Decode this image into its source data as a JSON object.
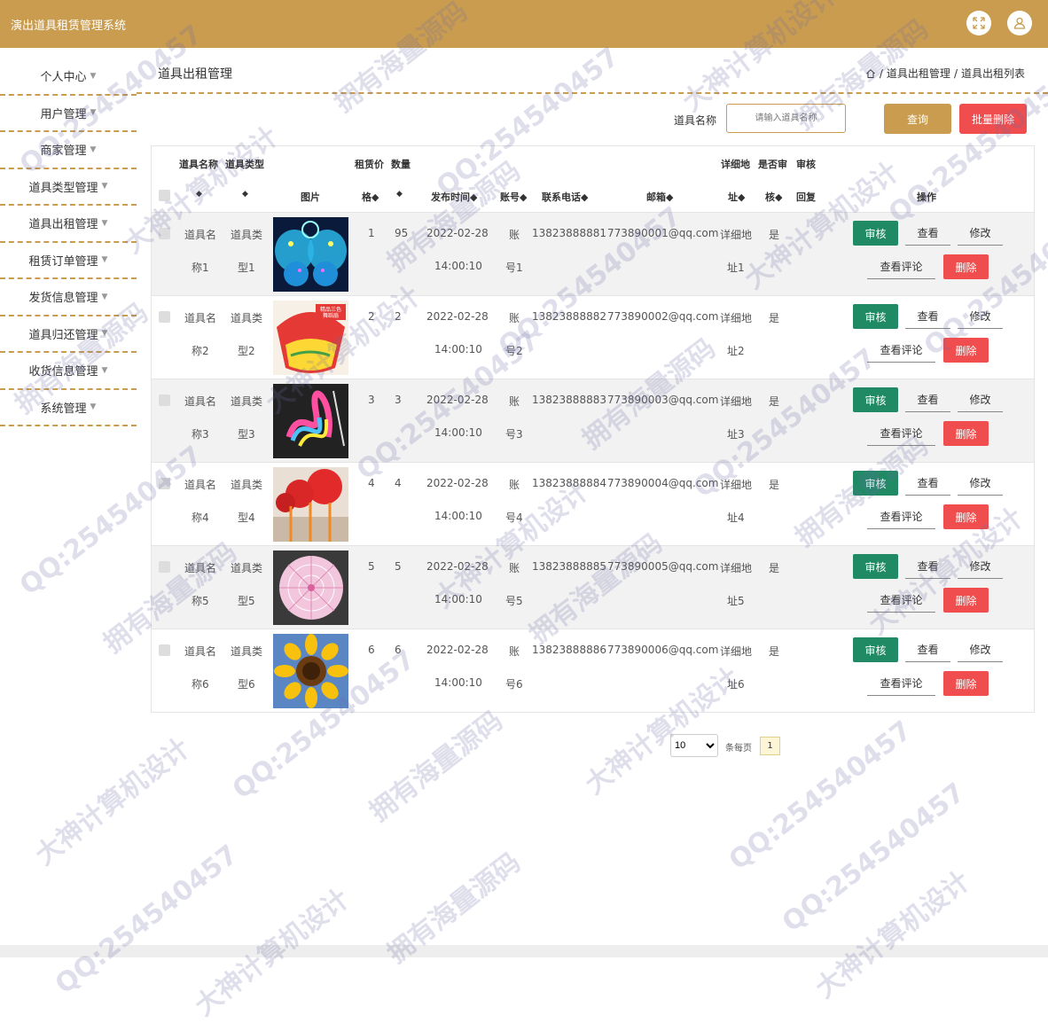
{
  "header": {
    "app_title": "演出道具租赁管理系统",
    "fullscreen_icon": "expand-icon",
    "user_icon": "user-icon"
  },
  "sidebar": {
    "items": [
      {
        "label": "个人中心"
      },
      {
        "label": "用户管理"
      },
      {
        "label": "商家管理"
      },
      {
        "label": "道具类型管理"
      },
      {
        "label": "道具出租管理"
      },
      {
        "label": "租赁订单管理"
      },
      {
        "label": "发货信息管理"
      },
      {
        "label": "道具归还管理"
      },
      {
        "label": "收货信息管理"
      },
      {
        "label": "系统管理"
      }
    ],
    "caret": "▼"
  },
  "page": {
    "title": "道具出租管理",
    "breadcrumb": [
      "/",
      "道具出租管理",
      "/",
      "道具出租列表"
    ]
  },
  "search": {
    "label": "道具名称",
    "placeholder": "请输入道具名称",
    "query_button": "查询",
    "batch_delete_button": "批量删除"
  },
  "table": {
    "header_line1": {
      "name": "道具名称",
      "type": "道具类型",
      "price": "租赁价",
      "qty": "数量",
      "addr": "详细地",
      "audit": "是否审",
      "audit2": "审核"
    },
    "header_line2": {
      "sort_name": "◆",
      "sort_type": "◆",
      "image": "图片",
      "price": "格◆",
      "qty": "◆",
      "time": "发布时间◆",
      "account": "账号◆",
      "phone": "联系电话◆",
      "email": "邮箱◆",
      "addr": "址◆",
      "audit": "核◆",
      "reply": "回复",
      "ops": "操作"
    },
    "rows": [
      {
        "name1": "道具名",
        "name2": "称1",
        "type1": "道具类",
        "type2": "型1",
        "price": "1",
        "qty": "95",
        "date": "2022-02-28",
        "time": "14:00:10",
        "acc1": "账",
        "acc2": "号1",
        "phone": "13823888881",
        "email": "773890001@qq.com",
        "addr1": "详细地",
        "addr2": "址1",
        "audited": "是"
      },
      {
        "name1": "道具名",
        "name2": "称2",
        "type1": "道具类",
        "type2": "型2",
        "price": "2",
        "qty": "2",
        "date": "2022-02-28",
        "time": "14:00:10",
        "acc1": "账",
        "acc2": "号2",
        "phone": "13823888882",
        "email": "773890002@qq.com",
        "addr1": "详细地",
        "addr2": "址2",
        "audited": "是"
      },
      {
        "name1": "道具名",
        "name2": "称3",
        "type1": "道具类",
        "type2": "型3",
        "price": "3",
        "qty": "3",
        "date": "2022-02-28",
        "time": "14:00:10",
        "acc1": "账",
        "acc2": "号3",
        "phone": "13823888883",
        "email": "773890003@qq.com",
        "addr1": "详细地",
        "addr2": "址3",
        "audited": "是"
      },
      {
        "name1": "道具名",
        "name2": "称4",
        "type1": "道具类",
        "type2": "型4",
        "price": "4",
        "qty": "4",
        "date": "2022-02-28",
        "time": "14:00:10",
        "acc1": "账",
        "acc2": "号4",
        "phone": "13823888884",
        "email": "773890004@qq.com",
        "addr1": "详细地",
        "addr2": "址4",
        "audited": "是"
      },
      {
        "name1": "道具名",
        "name2": "称5",
        "type1": "道具类",
        "type2": "型5",
        "price": "5",
        "qty": "5",
        "date": "2022-02-28",
        "time": "14:00:10",
        "acc1": "账",
        "acc2": "号5",
        "phone": "13823888885",
        "email": "773890005@qq.com",
        "addr1": "详细地",
        "addr2": "址5",
        "audited": "是"
      },
      {
        "name1": "道具名",
        "name2": "称6",
        "type1": "道具类",
        "type2": "型6",
        "price": "6",
        "qty": "6",
        "date": "2022-02-28",
        "time": "14:00:10",
        "acc1": "账",
        "acc2": "号6",
        "phone": "13823888886",
        "email": "773890006@qq.com",
        "addr1": "详细地",
        "addr2": "址6",
        "audited": "是"
      }
    ],
    "actions": {
      "audit": "审核",
      "view": "查看",
      "edit": "修改",
      "comments": "查看评论",
      "delete": "删除"
    },
    "thumb_badge": "精品三色 舞蹈扇"
  },
  "pagination": {
    "page_size": "10",
    "page_size_label": "条每页",
    "current_page": "1"
  },
  "watermarks": [
    "QQ:254540457",
    "拥有海量源码",
    "大神计算机设计"
  ],
  "colors": {
    "brand": "#c99c4f",
    "danger": "#f04e4e",
    "audit": "#1f8a63"
  }
}
